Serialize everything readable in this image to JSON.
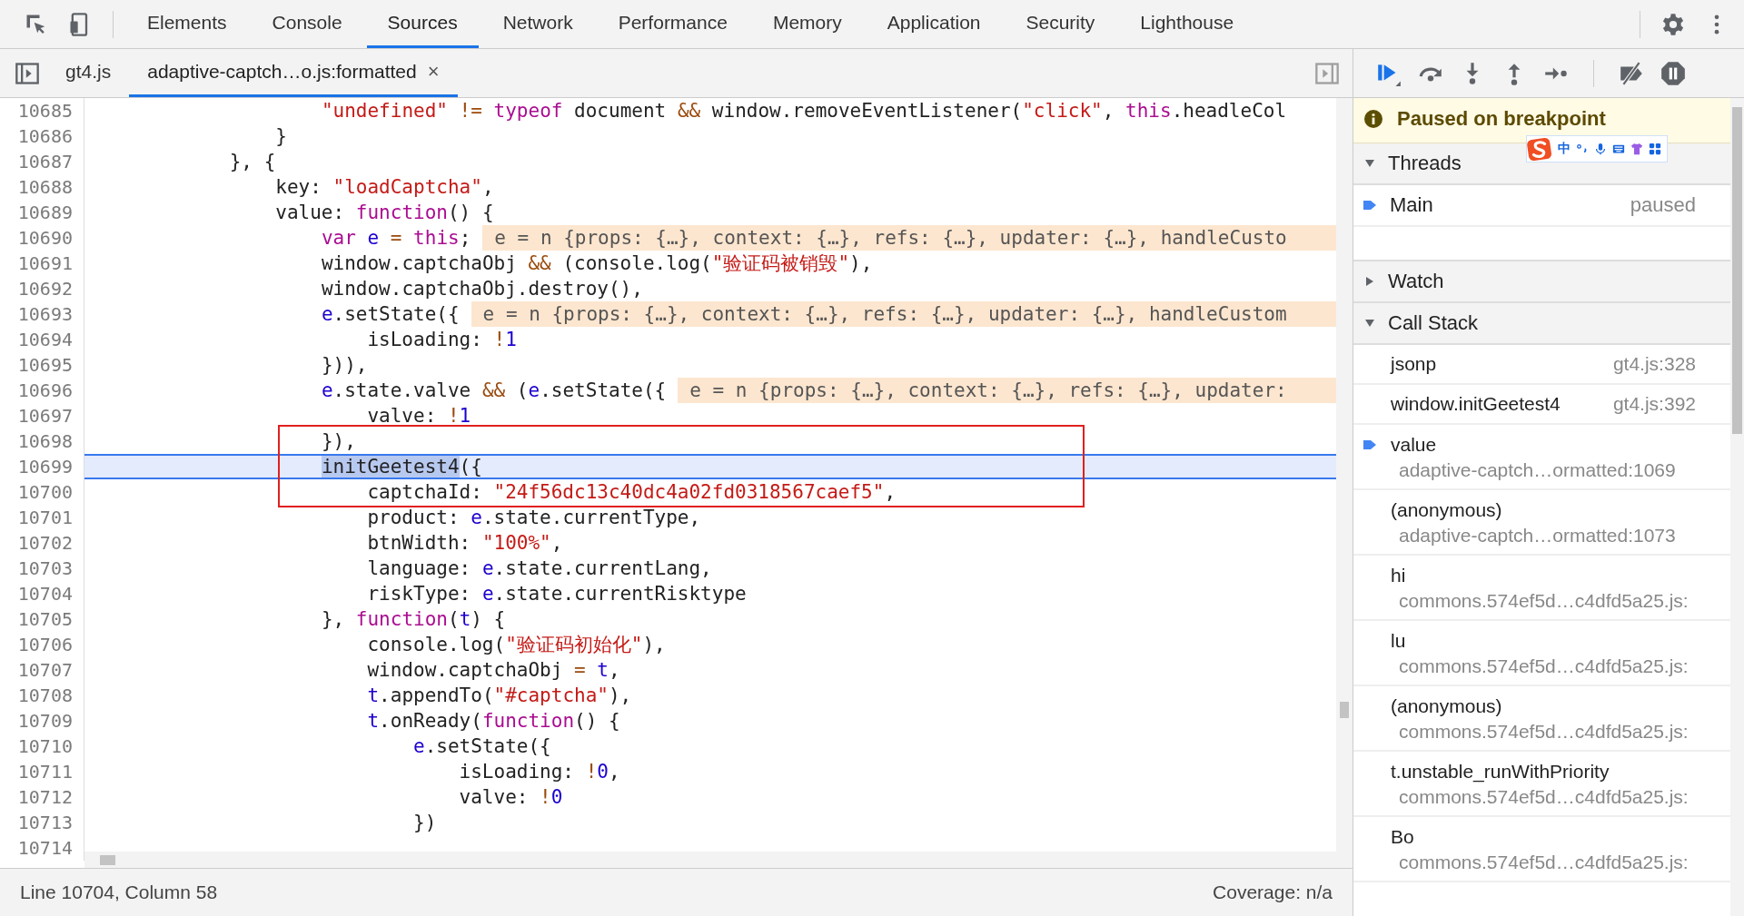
{
  "main_tabs": [
    {
      "label": "Elements",
      "selected": false
    },
    {
      "label": "Console",
      "selected": false
    },
    {
      "label": "Sources",
      "selected": true
    },
    {
      "label": "Network",
      "selected": false
    },
    {
      "label": "Performance",
      "selected": false
    },
    {
      "label": "Memory",
      "selected": false
    },
    {
      "label": "Application",
      "selected": false
    },
    {
      "label": "Security",
      "selected": false
    },
    {
      "label": "Lighthouse",
      "selected": false
    }
  ],
  "file_tabs": [
    {
      "label": "gt4.js",
      "selected": false
    },
    {
      "label": "adaptive-captch…o.js:formatted",
      "selected": true,
      "close": "×"
    }
  ],
  "editor": {
    "lines": [
      {
        "number": "10685",
        "tokens": [
          {
            "text": "                    \"undefined\"",
            "kind": "string"
          },
          {
            "text": " !=",
            "kind": "operator"
          },
          {
            "text": " typeof",
            "kind": "keyword"
          },
          {
            "text": " document",
            "kind": "plain"
          },
          {
            "text": " &&",
            "kind": "operator"
          },
          {
            "text": " window.removeEventListener(",
            "kind": "plain"
          },
          {
            "text": "\"click\"",
            "kind": "string"
          },
          {
            "text": ",",
            "kind": "plain"
          },
          {
            "text": " this",
            "kind": "keyword"
          },
          {
            "text": ".headleCol",
            "kind": "plain"
          }
        ]
      },
      {
        "number": "10686",
        "tokens": [
          {
            "text": "                }",
            "kind": "plain"
          }
        ]
      },
      {
        "number": "10687",
        "tokens": [
          {
            "text": "            }, {",
            "kind": "plain"
          }
        ]
      },
      {
        "number": "10688",
        "tokens": [
          {
            "text": "                key: ",
            "kind": "plain"
          },
          {
            "text": "\"loadCaptcha\"",
            "kind": "string"
          },
          {
            "text": ",",
            "kind": "plain"
          }
        ]
      },
      {
        "number": "10689",
        "tokens": [
          {
            "text": "                value: ",
            "kind": "plain"
          },
          {
            "text": "function",
            "kind": "keyword"
          },
          {
            "text": "() {",
            "kind": "plain"
          }
        ]
      },
      {
        "number": "10690",
        "tokens": [
          {
            "text": "                    var",
            "kind": "keyword"
          },
          {
            "text": " e",
            "kind": "variable"
          },
          {
            "text": " =",
            "kind": "operator"
          },
          {
            "text": " this",
            "kind": "keyword"
          },
          {
            "text": ";",
            "kind": "plain"
          }
        ],
        "hint": "e = n {props: {…}, context: {…}, refs: {…}, updater: {…}, handleCusto"
      },
      {
        "number": "10691",
        "tokens": [
          {
            "text": "                    window.captchaObj ",
            "kind": "plain"
          },
          {
            "text": "&&",
            "kind": "operator"
          },
          {
            "text": " (console.log(",
            "kind": "plain"
          },
          {
            "text": "\"验证码被销毁\"",
            "kind": "string"
          },
          {
            "text": "),",
            "kind": "plain"
          }
        ]
      },
      {
        "number": "10692",
        "tokens": [
          {
            "text": "                    window.captchaObj.destroy(),",
            "kind": "plain"
          }
        ]
      },
      {
        "number": "10693",
        "tokens": [
          {
            "text": "                    e",
            "kind": "variable"
          },
          {
            "text": ".setState({",
            "kind": "plain"
          }
        ],
        "hint": "e = n {props: {…}, context: {…}, refs: {…}, updater: {…}, handleCustom"
      },
      {
        "number": "10694",
        "tokens": [
          {
            "text": "                        isLoading: ",
            "kind": "plain"
          },
          {
            "text": "!",
            "kind": "operator"
          },
          {
            "text": "1",
            "kind": "number"
          }
        ]
      },
      {
        "number": "10695",
        "tokens": [
          {
            "text": "                    })),",
            "kind": "plain"
          }
        ]
      },
      {
        "number": "10696",
        "tokens": [
          {
            "text": "                    e",
            "kind": "variable"
          },
          {
            "text": ".state.valve ",
            "kind": "plain"
          },
          {
            "text": "&&",
            "kind": "operator"
          },
          {
            "text": " (",
            "kind": "plain"
          },
          {
            "text": "e",
            "kind": "variable"
          },
          {
            "text": ".setState({",
            "kind": "plain"
          }
        ],
        "hint": "e = n {props: {…}, context: {…}, refs: {…}, updater:"
      },
      {
        "number": "10697",
        "tokens": [
          {
            "text": "                        valve: ",
            "kind": "plain"
          },
          {
            "text": "!",
            "kind": "operator"
          },
          {
            "text": "1",
            "kind": "number"
          }
        ]
      },
      {
        "number": "10698",
        "boxed": true,
        "tokens": [
          {
            "text": "                    }),",
            "kind": "plain"
          }
        ]
      },
      {
        "number": "10699",
        "boxed": true,
        "current": true,
        "tokens": [
          {
            "text": "                    initGeetest4",
            "kind": "selection"
          },
          {
            "text": "({",
            "kind": "plain"
          }
        ]
      },
      {
        "number": "10700",
        "boxed": true,
        "tokens": [
          {
            "text": "                        captchaId: ",
            "kind": "plain"
          },
          {
            "text": "\"24f56dc13c40dc4a02fd0318567caef5\"",
            "kind": "string"
          },
          {
            "text": ",",
            "kind": "plain"
          }
        ]
      },
      {
        "number": "10701",
        "tokens": [
          {
            "text": "                        product: ",
            "kind": "plain"
          },
          {
            "text": "e",
            "kind": "variable"
          },
          {
            "text": ".state.currentType,",
            "kind": "plain"
          }
        ]
      },
      {
        "number": "10702",
        "tokens": [
          {
            "text": "                        btnWidth: ",
            "kind": "plain"
          },
          {
            "text": "\"100%\"",
            "kind": "string"
          },
          {
            "text": ",",
            "kind": "plain"
          }
        ]
      },
      {
        "number": "10703",
        "tokens": [
          {
            "text": "                        language: ",
            "kind": "plain"
          },
          {
            "text": "e",
            "kind": "variable"
          },
          {
            "text": ".state.currentLang,",
            "kind": "plain"
          }
        ]
      },
      {
        "number": "10704",
        "tokens": [
          {
            "text": "                        riskType: ",
            "kind": "plain"
          },
          {
            "text": "e",
            "kind": "variable"
          },
          {
            "text": ".state.currentRisktype",
            "kind": "plain"
          }
        ]
      },
      {
        "number": "10705",
        "tokens": [
          {
            "text": "                    }, ",
            "kind": "plain"
          },
          {
            "text": "function",
            "kind": "keyword"
          },
          {
            "text": "(",
            "kind": "plain"
          },
          {
            "text": "t",
            "kind": "variable"
          },
          {
            "text": ") {",
            "kind": "plain"
          }
        ]
      },
      {
        "number": "10706",
        "tokens": [
          {
            "text": "                        console.log(",
            "kind": "plain"
          },
          {
            "text": "\"验证码初始化\"",
            "kind": "string"
          },
          {
            "text": "),",
            "kind": "plain"
          }
        ]
      },
      {
        "number": "10707",
        "tokens": [
          {
            "text": "                        window.captchaObj ",
            "kind": "plain"
          },
          {
            "text": "=",
            "kind": "operator"
          },
          {
            "text": " t",
            "kind": "variable"
          },
          {
            "text": ",",
            "kind": "plain"
          }
        ]
      },
      {
        "number": "10708",
        "tokens": [
          {
            "text": "                        t",
            "kind": "variable"
          },
          {
            "text": ".appendTo(",
            "kind": "plain"
          },
          {
            "text": "\"#captcha\"",
            "kind": "string"
          },
          {
            "text": "),",
            "kind": "plain"
          }
        ]
      },
      {
        "number": "10709",
        "tokens": [
          {
            "text": "                        t",
            "kind": "variable"
          },
          {
            "text": ".onReady(",
            "kind": "plain"
          },
          {
            "text": "function",
            "kind": "keyword"
          },
          {
            "text": "() {",
            "kind": "plain"
          }
        ]
      },
      {
        "number": "10710",
        "tokens": [
          {
            "text": "                            e",
            "kind": "variable"
          },
          {
            "text": ".setState({",
            "kind": "plain"
          }
        ]
      },
      {
        "number": "10711",
        "tokens": [
          {
            "text": "                                isLoading: ",
            "kind": "plain"
          },
          {
            "text": "!",
            "kind": "operator"
          },
          {
            "text": "0",
            "kind": "number"
          },
          {
            "text": ",",
            "kind": "plain"
          }
        ]
      },
      {
        "number": "10712",
        "tokens": [
          {
            "text": "                                valve: ",
            "kind": "plain"
          },
          {
            "text": "!",
            "kind": "operator"
          },
          {
            "text": "0",
            "kind": "number"
          }
        ]
      },
      {
        "number": "10713",
        "tokens": [
          {
            "text": "                            })",
            "kind": "plain"
          }
        ]
      },
      {
        "number": "10714"
      }
    ]
  },
  "status_bar": {
    "position": "Line 10704, Column 58",
    "coverage": "Coverage: n/a"
  },
  "debugger": {
    "banner": "Paused on breakpoint",
    "ime_toolbar": {
      "label": "中"
    },
    "threads": {
      "title": "Threads",
      "expanded": true,
      "items": [
        {
          "name": "Main",
          "status": "paused",
          "selected": true
        }
      ]
    },
    "watch": {
      "title": "Watch",
      "expanded": false
    },
    "call_stack": {
      "title": "Call Stack",
      "expanded": true,
      "frames": [
        {
          "name": "jsonp",
          "location": "gt4.js:328",
          "kind": "inline",
          "selected": false
        },
        {
          "name": "window.initGeetest4",
          "location": "gt4.js:392",
          "kind": "inline",
          "selected": false
        },
        {
          "name": "value",
          "location": "adaptive-captch…ormatted:1069",
          "kind": "stacked",
          "selected": true
        },
        {
          "name": "(anonymous)",
          "location": "adaptive-captch…ormatted:1073",
          "kind": "stacked",
          "selected": false
        },
        {
          "name": "hi",
          "location": "commons.574ef5d…c4dfd5a25.js:",
          "kind": "stacked",
          "selected": false
        },
        {
          "name": "lu",
          "location": "commons.574ef5d…c4dfd5a25.js:",
          "kind": "stacked",
          "selected": false
        },
        {
          "name": "(anonymous)",
          "location": "commons.574ef5d…c4dfd5a25.js:",
          "kind": "stacked",
          "selected": false
        },
        {
          "name": "t.unstable_runWithPriority",
          "location": "commons.574ef5d…c4dfd5a25.js:",
          "kind": "stacked",
          "selected": false
        },
        {
          "name": "Bo",
          "location": "commons.574ef5d…c4dfd5a25.js:",
          "kind": "stacked",
          "selected": false
        }
      ]
    }
  }
}
